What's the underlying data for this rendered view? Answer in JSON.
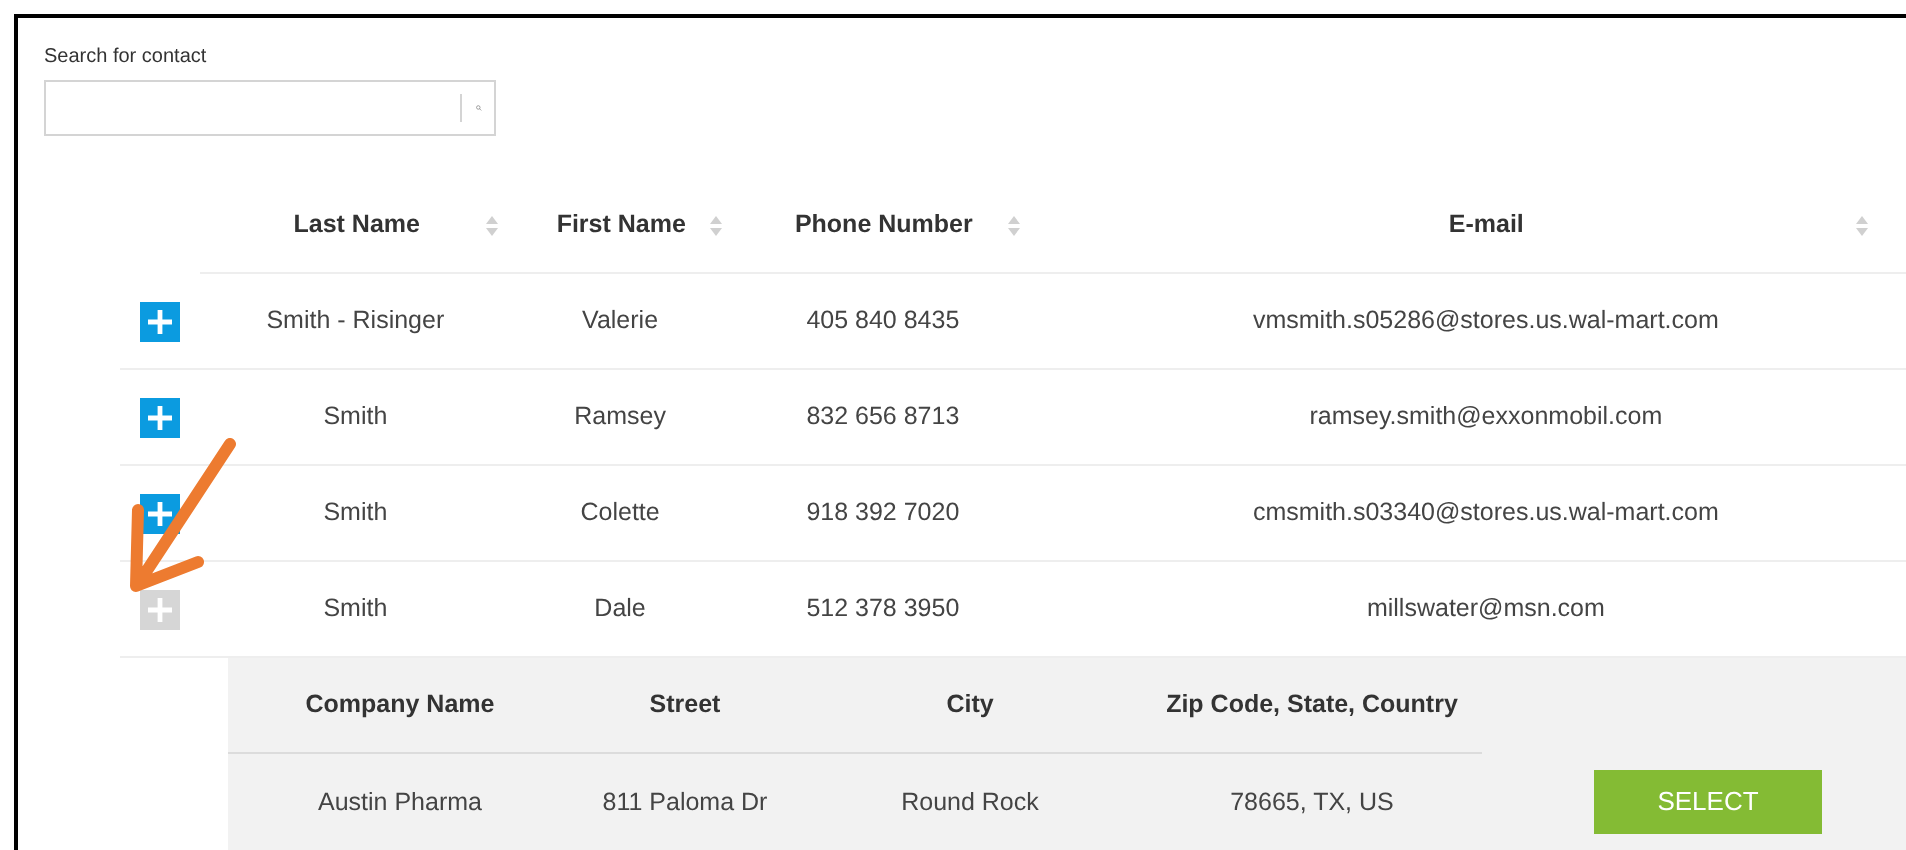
{
  "search": {
    "label": "Search for contact"
  },
  "table": {
    "columns": [
      "Last Name",
      "First Name",
      "Phone Number",
      "E-mail"
    ],
    "rows": [
      {
        "last_name": "Smith - Risinger",
        "first_name": "Valerie",
        "phone": "405 840 8435",
        "email": "vmsmith.s05286@stores.us.wal-mart.com",
        "expanded": false
      },
      {
        "last_name": "Smith",
        "first_name": "Ramsey",
        "phone": "832 656 8713",
        "email": "ramsey.smith@exxonmobil.com",
        "expanded": false
      },
      {
        "last_name": "Smith",
        "first_name": "Colette",
        "phone": "918 392 7020",
        "email": "cmsmith.s03340@stores.us.wal-mart.com",
        "expanded": false
      },
      {
        "last_name": "Smith",
        "first_name": "Dale",
        "phone": "512 378 3950",
        "email": "millswater@msn.com",
        "expanded": true,
        "details": {
          "columns": [
            "Company Name",
            "Street",
            "City",
            "Zip Code, State, Country"
          ],
          "rows": [
            {
              "company": "Austin Pharma",
              "street": "811 Paloma Dr",
              "city": "Round Rock",
              "zip_state_country": "78665, TX, US",
              "button": "SELECT"
            }
          ]
        }
      }
    ]
  }
}
